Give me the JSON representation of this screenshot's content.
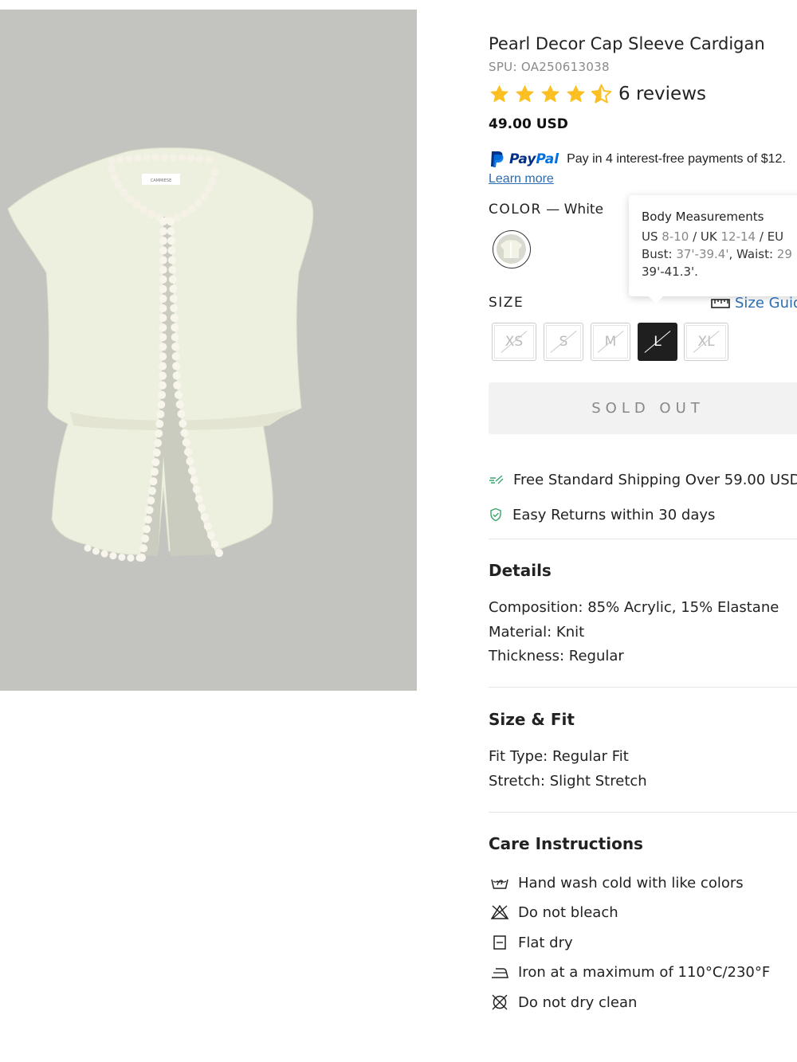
{
  "product": {
    "title": "Pearl Decor Cap Sleeve Cardigan",
    "spu": "SPU: OA250613038",
    "rating": 4.5,
    "reviews": "6 reviews",
    "price": "49.00 USD",
    "image_label": "CAMMIESE"
  },
  "paypal": {
    "brand_pay": "Pay",
    "brand_pal": "Pal",
    "text": "Pay in 4 interest-free payments of $12.",
    "learn_more": "Learn more"
  },
  "color": {
    "label": "COLOR",
    "separator": " — ",
    "value": "White"
  },
  "tooltip": {
    "title": "Body Measurements",
    "us_label": "US ",
    "us_value": "8-10",
    "uk_label": " / UK ",
    "uk_value": "12-14",
    "eu_label": " / EU",
    "bust_label": "Bust: ",
    "bust_value": "37'-39.4'",
    "waist_label": ", Waist: ",
    "waist_value": "29",
    "hip_value": "39'-41.3'."
  },
  "size": {
    "label": "SIZE",
    "guide": "Size Guide",
    "options": [
      {
        "label": "XS",
        "available": false,
        "selected": false
      },
      {
        "label": "S",
        "available": false,
        "selected": false
      },
      {
        "label": "M",
        "available": false,
        "selected": false
      },
      {
        "label": "L",
        "available": false,
        "selected": true
      },
      {
        "label": "XL",
        "available": false,
        "selected": false
      }
    ]
  },
  "sold_out": "SOLD OUT",
  "perks": {
    "shipping": "Free Standard Shipping Over 59.00 USD",
    "returns": "Easy Returns within 30 days"
  },
  "details": {
    "title": "Details",
    "composition": "Composition: 85% Acrylic, 15% Elastane",
    "material": "Material: Knit",
    "thickness": "Thickness: Regular"
  },
  "size_fit": {
    "title": "Size & Fit",
    "fit_type": "Fit Type: Regular Fit",
    "stretch": "Stretch: Slight Stretch"
  },
  "care": {
    "title": "Care Instructions",
    "items": [
      {
        "icon": "hand-wash-icon",
        "text": "Hand wash cold with like colors"
      },
      {
        "icon": "no-bleach-icon",
        "text": "Do not bleach"
      },
      {
        "icon": "flat-dry-icon",
        "text": "Flat dry"
      },
      {
        "icon": "iron-icon",
        "text": "Iron at a maximum of 110°C/230°F"
      },
      {
        "icon": "no-dry-clean-icon",
        "text": "Do not dry clean"
      }
    ]
  },
  "colors": {
    "star": "#fbbf24",
    "link": "#2a6db2",
    "paypal_dark": "#003087",
    "paypal_light": "#0070e0",
    "accent_green": "#3aa56b",
    "image_bg": "#c3c4bf"
  }
}
